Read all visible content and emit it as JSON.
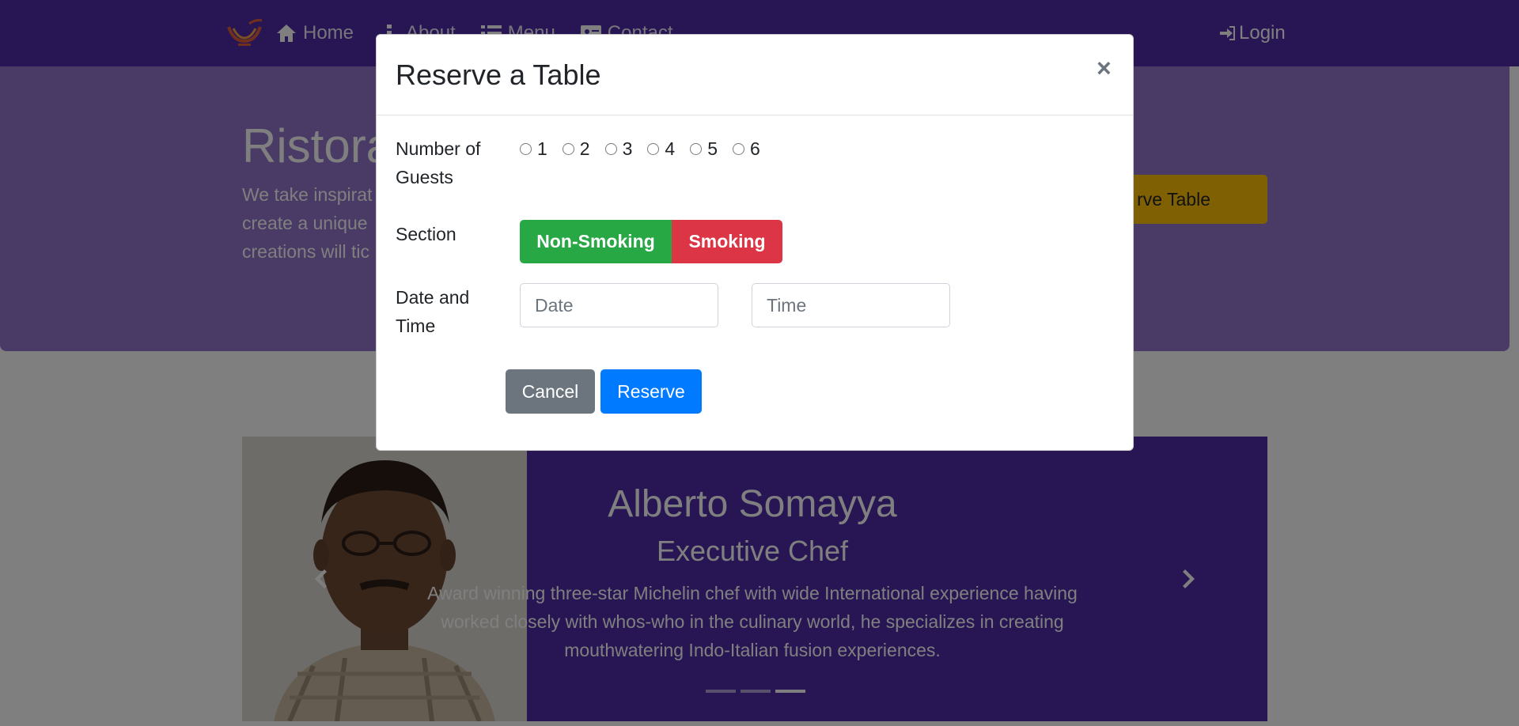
{
  "navbar": {
    "logo_icon": "restaurant-logo-icon",
    "links": [
      {
        "label": "Home",
        "icon": "home-icon"
      },
      {
        "label": "About",
        "icon": "info-icon"
      },
      {
        "label": "Menu",
        "icon": "list-icon"
      },
      {
        "label": "Contact",
        "icon": "address-card-icon"
      }
    ],
    "login": {
      "label": "Login",
      "icon": "sign-in-icon"
    },
    "color": "#512da8"
  },
  "jumbotron": {
    "title": "Ristora",
    "text_lines": [
      "We take inspirat",
      "create a unique",
      "creations will tic"
    ],
    "reserve_button": "rve Table",
    "color": "#9575cd"
  },
  "carousel": {
    "name": "Alberto Somayya",
    "role": "Executive Chef",
    "description": "Award winning three-star Michelin chef with wide International experience having worked closely with whos-who in the culinary world, he specializes in creating mouthwatering Indo-Italian fusion experiences.",
    "indicator_count": 3,
    "active_indicator": 3
  },
  "modal": {
    "title": "Reserve a Table",
    "close": "×",
    "guests": {
      "label": "Number of Guests",
      "options": [
        "1",
        "2",
        "3",
        "4",
        "5",
        "6"
      ]
    },
    "section": {
      "label": "Section",
      "non_smoking": "Non-Smoking",
      "smoking": "Smoking"
    },
    "datetime": {
      "label": "Date and Time",
      "date_placeholder": "Date",
      "time_placeholder": "Time"
    },
    "buttons": {
      "cancel": "Cancel",
      "reserve": "Reserve"
    }
  },
  "colors": {
    "success": "#28a745",
    "danger": "#dc3545",
    "primary": "#007bff",
    "secondary": "#6c757d",
    "warning": "#ffc107"
  }
}
